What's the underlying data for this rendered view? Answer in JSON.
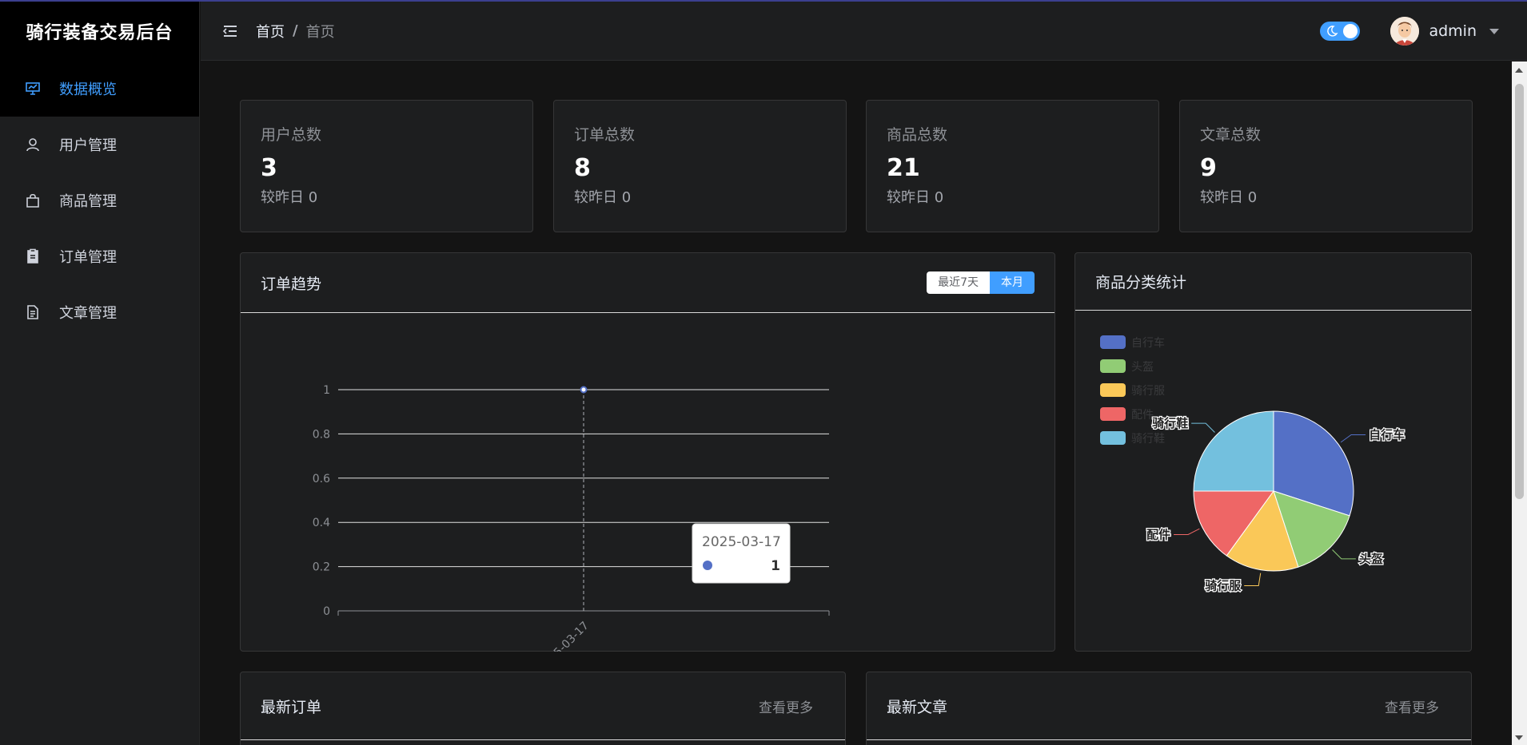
{
  "brand": {
    "title": "骑行装备交易后台"
  },
  "sidebar": {
    "items": [
      {
        "label": "数据概览",
        "icon": "presentation-chart-icon",
        "active": true
      },
      {
        "label": "用户管理",
        "icon": "user-icon",
        "active": false
      },
      {
        "label": "商品管理",
        "icon": "shopping-bag-icon",
        "active": false
      },
      {
        "label": "订单管理",
        "icon": "clipboard-icon",
        "active": false
      },
      {
        "label": "文章管理",
        "icon": "document-icon",
        "active": false
      }
    ]
  },
  "header": {
    "breadcrumb": [
      "首页",
      "首页"
    ],
    "separator": "/",
    "user": {
      "name": "admin"
    },
    "theme_toggle": {
      "dark_mode": true
    }
  },
  "stats": [
    {
      "label": "用户总数",
      "value": "3",
      "compare": "较昨日 0"
    },
    {
      "label": "订单总数",
      "value": "8",
      "compare": "较昨日 0"
    },
    {
      "label": "商品总数",
      "value": "21",
      "compare": "较昨日 0"
    },
    {
      "label": "文章总数",
      "value": "9",
      "compare": "较昨日 0"
    }
  ],
  "order_trend": {
    "title": "订单趋势",
    "range_options": [
      "最近7天",
      "本月"
    ],
    "selected_range": "本月",
    "tooltip": {
      "date": "2025-03-17",
      "value": "1"
    }
  },
  "category_stats": {
    "title": "商品分类统计"
  },
  "latest_orders": {
    "title": "最新订单",
    "more": "查看更多"
  },
  "latest_articles": {
    "title": "最新文章",
    "more": "查看更多"
  },
  "colors": {
    "accent": "#409eff",
    "bg": "#141414",
    "card": "#1d1e1f"
  },
  "chart_data": [
    {
      "type": "line",
      "x": [
        "2025-03-17"
      ],
      "series": [
        {
          "values": [
            1
          ]
        }
      ],
      "ylim": [
        0,
        1
      ],
      "yticks": [
        "0",
        "0.2",
        "0.4",
        "0.6",
        "0.8",
        "1"
      ],
      "grid": true
    },
    {
      "type": "pie",
      "labels": [
        "自行车",
        "头盔",
        "骑行服",
        "配件",
        "骑行鞋"
      ],
      "values": [
        6,
        3,
        3,
        3,
        5
      ],
      "colors": [
        "#5470c6",
        "#91cc75",
        "#fac858",
        "#ee6666",
        "#73c0de"
      ],
      "legend": "top-left"
    }
  ]
}
